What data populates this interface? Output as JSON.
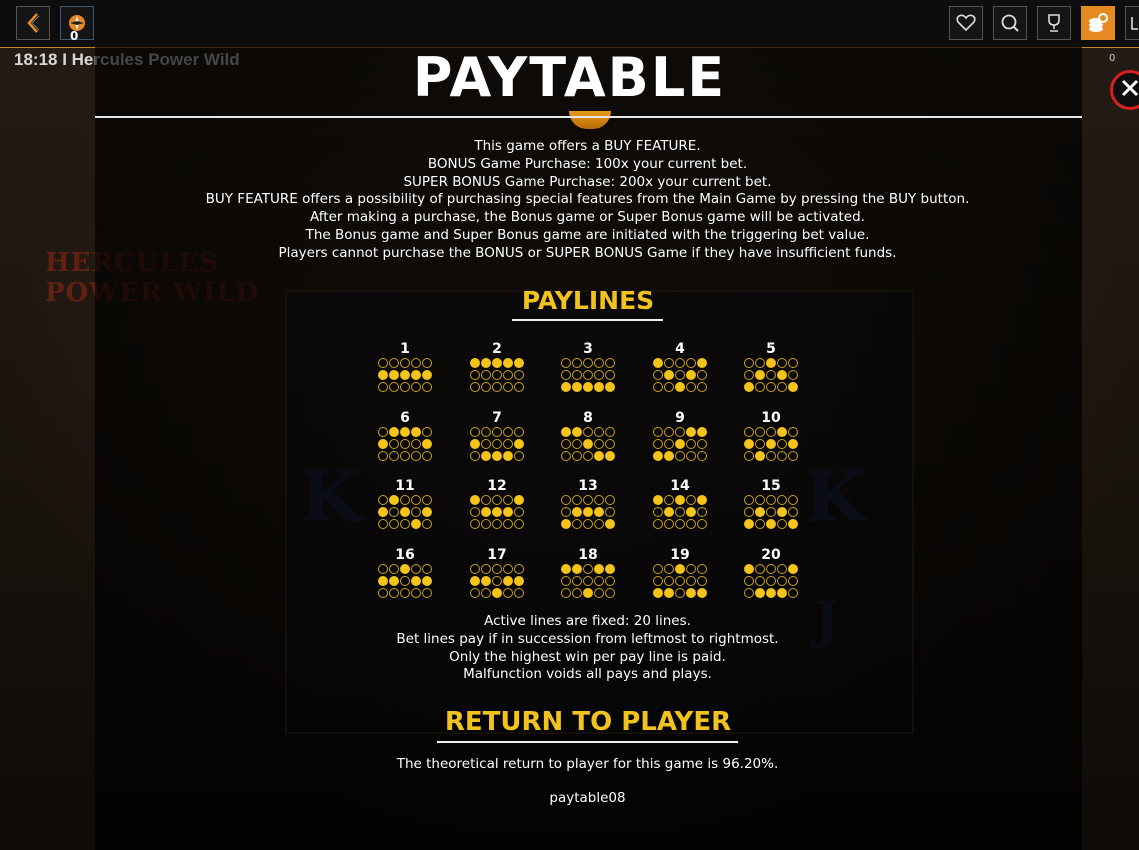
{
  "topbar": {
    "back_icon": "chevron-left-icon",
    "badge_icon": "compass-badge-icon",
    "badge_count": "0",
    "favorite_icon": "heart-icon",
    "search_icon": "search-icon",
    "trophy_icon": "trophy-icon",
    "coins_icon": "coins-icon",
    "side_count": "0"
  },
  "game_header": {
    "time_title": "18:18 I Hercules Power Wild"
  },
  "paytable": {
    "title": "PAYTABLE",
    "buy_feature_lines": [
      "This game offers a BUY FEATURE.",
      "BONUS Game Purchase: 100x your current bet.",
      "SUPER BONUS Game Purchase: 200x your current bet.",
      "BUY FEATURE offers a possibility of purchasing special features from the Main Game by pressing the BUY button.",
      "After making a purchase, the Bonus game or Super Bonus game will be activated.",
      "The Bonus game and Super Bonus game are initiated with the triggering bet value.",
      "Players cannot purchase the BONUS or SUPER BONUS Game if they have insufficient funds."
    ],
    "paylines_heading": "PAYLINES",
    "paylines": [
      {
        "label": "1",
        "rows": [
          1,
          1,
          1,
          1,
          1
        ]
      },
      {
        "label": "2",
        "rows": [
          0,
          0,
          0,
          0,
          0
        ]
      },
      {
        "label": "3",
        "rows": [
          2,
          2,
          2,
          2,
          2
        ]
      },
      {
        "label": "4",
        "rows": [
          0,
          1,
          2,
          1,
          0
        ]
      },
      {
        "label": "5",
        "rows": [
          2,
          1,
          0,
          1,
          2
        ]
      },
      {
        "label": "6",
        "rows": [
          1,
          0,
          0,
          0,
          1
        ]
      },
      {
        "label": "7",
        "rows": [
          1,
          2,
          2,
          2,
          1
        ]
      },
      {
        "label": "8",
        "rows": [
          0,
          0,
          1,
          2,
          2
        ]
      },
      {
        "label": "9",
        "rows": [
          2,
          2,
          1,
          0,
          0
        ]
      },
      {
        "label": "10",
        "rows": [
          1,
          2,
          1,
          0,
          1
        ]
      },
      {
        "label": "11",
        "rows": [
          1,
          0,
          1,
          2,
          1
        ]
      },
      {
        "label": "12",
        "rows": [
          0,
          1,
          1,
          1,
          0
        ]
      },
      {
        "label": "13",
        "rows": [
          2,
          1,
          1,
          1,
          2
        ]
      },
      {
        "label": "14",
        "rows": [
          0,
          1,
          0,
          1,
          0
        ]
      },
      {
        "label": "15",
        "rows": [
          2,
          1,
          2,
          1,
          2
        ]
      },
      {
        "label": "16",
        "rows": [
          1,
          1,
          0,
          1,
          1
        ]
      },
      {
        "label": "17",
        "rows": [
          1,
          1,
          2,
          1,
          1
        ]
      },
      {
        "label": "18",
        "rows": [
          0,
          0,
          2,
          0,
          0
        ]
      },
      {
        "label": "19",
        "rows": [
          2,
          2,
          0,
          2,
          2
        ]
      },
      {
        "label": "20",
        "rows": [
          0,
          2,
          2,
          2,
          0
        ]
      }
    ],
    "rules_lines": [
      "Active lines are fixed: 20 lines.",
      "Bet lines pay if in succession from leftmost to rightmost.",
      "Only the highest win per pay line is paid.",
      "Malfunction voids all pays and plays."
    ],
    "rtp_heading": "RETURN TO PLAYER",
    "rtp_text": "The theoretical return to player for this game is 96.20%.",
    "page_id": "paytable08"
  },
  "colors": {
    "accent": "#e58a22",
    "gold": "#f2c21d",
    "close": "#d82020"
  }
}
